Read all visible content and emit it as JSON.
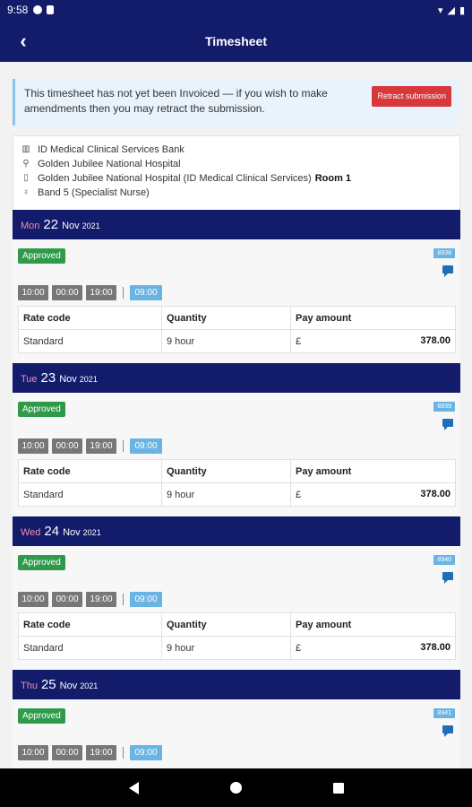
{
  "status_bar": {
    "time": "9:58"
  },
  "app_bar": {
    "title": "Timesheet"
  },
  "alert": {
    "message": "This timesheet has not yet been Invoiced — if you wish to make amendments then you may retract the submission.",
    "retract_label": "Retract submission"
  },
  "info": {
    "agency": "ID Medical Clinical Services Bank",
    "hospital": "Golden Jubilee National Hospital",
    "ward": "Golden Jubilee National Hospital (ID Medical Clinical Services)",
    "room": "Room 1",
    "band": "Band 5 (Specialist Nurse)"
  },
  "table_headers": {
    "rate_code": "Rate code",
    "quantity": "Quantity",
    "pay_amount": "Pay amount"
  },
  "days": [
    {
      "day_name": "Mon",
      "day_num": "22",
      "month": "Nov",
      "year": "2021",
      "status": "Approved",
      "id_badge": "8938",
      "start": "10:00",
      "break": "00:00",
      "end": "19:00",
      "total": "09:00",
      "rate_code": "Standard",
      "quantity": "9 hour",
      "currency": "£",
      "amount": "378.00"
    },
    {
      "day_name": "Tue",
      "day_num": "23",
      "month": "Nov",
      "year": "2021",
      "status": "Approved",
      "id_badge": "8939",
      "start": "10:00",
      "break": "00:00",
      "end": "19:00",
      "total": "09:00",
      "rate_code": "Standard",
      "quantity": "9 hour",
      "currency": "£",
      "amount": "378.00"
    },
    {
      "day_name": "Wed",
      "day_num": "24",
      "month": "Nov",
      "year": "2021",
      "status": "Approved",
      "id_badge": "8940",
      "start": "10:00",
      "break": "00:00",
      "end": "19:00",
      "total": "09:00",
      "rate_code": "Standard",
      "quantity": "9 hour",
      "currency": "£",
      "amount": "378.00"
    },
    {
      "day_name": "Thu",
      "day_num": "25",
      "month": "Nov",
      "year": "2021",
      "status": "Approved",
      "id_badge": "8941",
      "start": "10:00",
      "break": "00:00",
      "end": "19:00",
      "total": "09:00"
    }
  ],
  "colors": {
    "primary": "#131c6b",
    "approved": "#2f9b4a",
    "retract": "#d9383a",
    "total_chip": "#6ab4e4",
    "day_name": "#f08ab2"
  }
}
